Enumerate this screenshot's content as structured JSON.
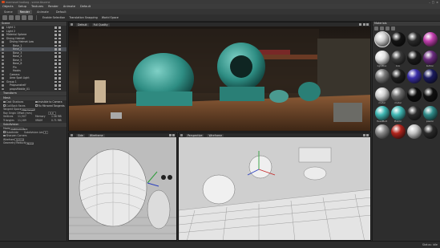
{
  "window": {
    "title": "marmoset toolbag - scene.tbscene"
  },
  "menu": [
    "Objects",
    "Setup",
    "Textures",
    "Render",
    "Animate",
    "Default"
  ],
  "tabs": [
    {
      "label": "Scene",
      "active": false
    },
    {
      "label": "Render",
      "active": true
    },
    {
      "label": "Animate",
      "active": false
    },
    {
      "label": "Default",
      "active": false
    }
  ],
  "toolbar": {
    "items": [
      "Enable Selection",
      "Translation Snapping",
      "World Space"
    ]
  },
  "scene_panel": {
    "header": "Scene",
    "tree": [
      {
        "label": "Light 1",
        "indent": 1,
        "sel": false
      },
      {
        "label": "Light 2",
        "indent": 1,
        "sel": false
      },
      {
        "label": "Material Sphere",
        "indent": 1,
        "sel": false
      },
      {
        "label": "Diving Helmet",
        "indent": 1,
        "sel": false
      },
      {
        "label": "Diving Helmet Low",
        "indent": 2,
        "sel": false
      },
      {
        "label": "Base_1",
        "indent": 3,
        "sel": false
      },
      {
        "label": "Base_2",
        "indent": 3,
        "sel": true
      },
      {
        "label": "Base_3",
        "indent": 3,
        "sel": false
      },
      {
        "label": "Base_4",
        "indent": 3,
        "sel": false
      },
      {
        "label": "Base_5",
        "indent": 3,
        "sel": false
      },
      {
        "label": "Base_6",
        "indent": 3,
        "sel": false
      },
      {
        "label": "Pin",
        "indent": 3,
        "sel": false
      },
      {
        "label": "Hooks",
        "indent": 3,
        "sel": false
      },
      {
        "label": "Camera",
        "indent": 2,
        "sel": false
      },
      {
        "label": "Area Spot Light",
        "indent": 2,
        "sel": false
      },
      {
        "label": "Group 1",
        "indent": 1,
        "sel": false
      },
      {
        "label": "Propsonshelf",
        "indent": 2,
        "sel": false
      },
      {
        "label": "propsMiddle_01",
        "indent": 2,
        "sel": false
      }
    ],
    "transform_header": "Transform",
    "mesh_header": "Mesh",
    "mesh_props": [
      {
        "label": "Cast Shadows",
        "value": "Invisible to Camera"
      },
      {
        "label": "Cull Back Faces",
        "value": "Fix Mirrored Tangents"
      }
    ],
    "tangent_label": "Tangent Space",
    "tangent_value": "Marmoset",
    "ray_label": "Ray Origin Offset (mm)",
    "ray_value": "0.0",
    "stats": [
      {
        "label": "Vertices",
        "value": "11,507",
        "label2": "Memory",
        "value2": "1.56 MB"
      },
      {
        "label": "Triangles",
        "value": "11,169",
        "label2": "VRAM",
        "value2": "0.71 MB"
      }
    ],
    "subdiv_header": "Subdivision",
    "subdiv_mode_label": "Mode",
    "subdiv_mode_value": "Catmull-Clark",
    "subdivide_label": "Subdivide",
    "subdiv_level_label": "Subdivision Level",
    "subdiv_level_value": "0",
    "sharpen_label": "Sharpen Corners",
    "wireframe_label": "Wireframe",
    "wireframe_value": "Isoline",
    "geo_reduction_label": "Geometry Reduction",
    "geo_reduction_value": "None"
  },
  "viewport_main": {
    "view": "Default",
    "mode": "Full Quality"
  },
  "viewport_side": {
    "view": "Side",
    "mode": "Wireframe"
  },
  "viewport_persp": {
    "view": "Perspective",
    "mode": "Wireframe"
  },
  "materials": {
    "header": "Materials",
    "items": [
      {
        "label": "",
        "color": "#cfcfcf",
        "sel": true
      },
      {
        "label": "",
        "color": "#141414",
        "sel": false
      },
      {
        "label": "",
        "color": "#2a2a2a",
        "sel": false
      },
      {
        "label": "",
        "color": "#c23fae",
        "sel": false
      },
      {
        "label": "lightBox",
        "color": "#e2e2e2",
        "sel": false
      },
      {
        "label": "box",
        "color": "#3a3a3a",
        "sel": false
      },
      {
        "label": "",
        "color": "#1a1a1a",
        "sel": false
      },
      {
        "label": "button",
        "color": "#6a2c7e",
        "sel": false
      },
      {
        "label": "",
        "color": "#7a7a7a",
        "sel": false
      },
      {
        "label": "",
        "color": "#1e1e1e",
        "sel": false
      },
      {
        "label": "",
        "color": "#3a2fa8",
        "sel": false
      },
      {
        "label": "",
        "color": "#1b1b5e",
        "sel": false
      },
      {
        "label": "metal",
        "color": "#d0d0d0",
        "sel": false
      },
      {
        "label": "metal",
        "color": "#6b6b6b",
        "sel": false
      },
      {
        "label": "",
        "color": "#0c0c0c",
        "sel": false
      },
      {
        "label": "",
        "color": "#101010",
        "sel": false
      },
      {
        "label": "HeadBolt",
        "color": "#3fb7b3",
        "sel": false
      },
      {
        "label": "Plastic",
        "color": "#3fb7b3",
        "sel": false
      },
      {
        "label": "",
        "color": "#2c2c2c",
        "sel": false
      },
      {
        "label": "plastic",
        "color": "#2f8a88",
        "sel": false
      },
      {
        "label": "",
        "color": "#8a8a8a",
        "sel": false
      },
      {
        "label": "",
        "color": "#b1241c",
        "sel": false
      },
      {
        "label": "",
        "color": "#c4c4c4",
        "sel": false
      },
      {
        "label": "",
        "color": "#2a2a2a",
        "sel": false
      }
    ]
  },
  "status": {
    "text": "Status: idle"
  }
}
